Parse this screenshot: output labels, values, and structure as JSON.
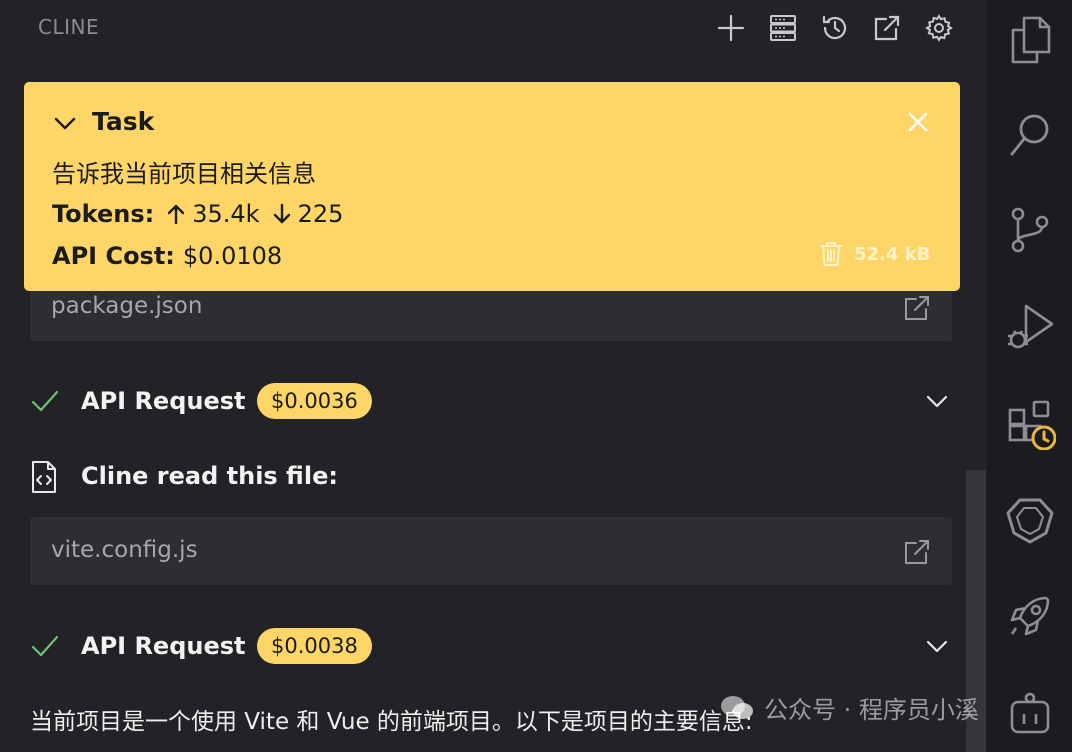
{
  "header": {
    "title": "CLINE",
    "buttons": [
      "plus-icon",
      "server-icon",
      "history-icon",
      "popout-icon",
      "gear-icon"
    ]
  },
  "task": {
    "title": "Task",
    "text": "告诉我当前项目相关信息",
    "tokens_label": "Tokens:",
    "tokens_up": "35.4k",
    "tokens_down": "225",
    "cost_label": "API Cost:",
    "cost_value": "$0.0108",
    "size": "52.4 kB"
  },
  "files": [
    {
      "name": "package.json"
    },
    {
      "name": "vite.config.js"
    }
  ],
  "api_requests": [
    {
      "label": "API Request",
      "cost": "$0.0036"
    },
    {
      "label": "API Request",
      "cost": "$0.0038"
    }
  ],
  "read_file": {
    "label": "Cline read this file:"
  },
  "answer": "当前项目是一个使用 Vite 和 Vue 的前端项目。以下是项目的主要信息:",
  "watermark": "公众号 · 程序员小溪",
  "colors": {
    "accent": "#fed567",
    "background": "#232227",
    "row": "#2e2d33",
    "check": "#6fc17a"
  }
}
